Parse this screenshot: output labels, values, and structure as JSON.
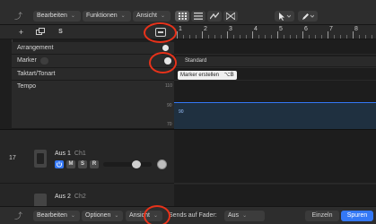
{
  "toolbar": {
    "menus": [
      {
        "label": "Bearbeiten"
      },
      {
        "label": "Funktionen"
      },
      {
        "label": "Ansicht"
      }
    ]
  },
  "track_header": {
    "add_label": "+",
    "s_label": "S"
  },
  "global_tracks": [
    {
      "label": "Arrangement"
    },
    {
      "label": "Marker"
    },
    {
      "label": "Taktart/Tonart"
    },
    {
      "label": "Tempo"
    }
  ],
  "ruler": {
    "bars": [
      "1",
      "2",
      "3",
      "4",
      "5",
      "6",
      "7",
      "8"
    ]
  },
  "marker_lane": {
    "text": "Standard"
  },
  "tooltip": {
    "text": "Marker erstellen",
    "shortcut": "⌥B"
  },
  "tempo": {
    "values": [
      "110",
      "90",
      "70"
    ],
    "current": "90"
  },
  "tracks": [
    {
      "number": "17",
      "name": "Aus 1",
      "channel": "Ch1",
      "buttons": [
        "M",
        "S",
        "R"
      ]
    },
    {
      "name": "Aus 2",
      "channel": "Ch2"
    }
  ],
  "bottombar": {
    "menus": [
      {
        "label": "Bearbeiten"
      },
      {
        "label": "Optionen"
      },
      {
        "label": "Ansicht"
      }
    ],
    "sends_label": "Sends auf Fader:",
    "sends_value": "Aus",
    "view_single": "Einzeln",
    "view_tracks": "Spuren"
  },
  "colors": {
    "accent": "#3478f6",
    "annotation": "#e8321a",
    "tempo_region": "#1f3040"
  },
  "icons": {
    "back": "back-arrow-icon",
    "grid": "grid-icon",
    "list": "list-icon",
    "smart": "smart-control-icon",
    "flex": "flex-icon",
    "pointer": "pointer-tool-icon",
    "pencil": "pencil-tool-icon",
    "add_marker": "add-marker-icon",
    "plus": "plus-icon",
    "duplicate": "duplicate-icon",
    "power": "power-icon",
    "record": "record-icon"
  }
}
